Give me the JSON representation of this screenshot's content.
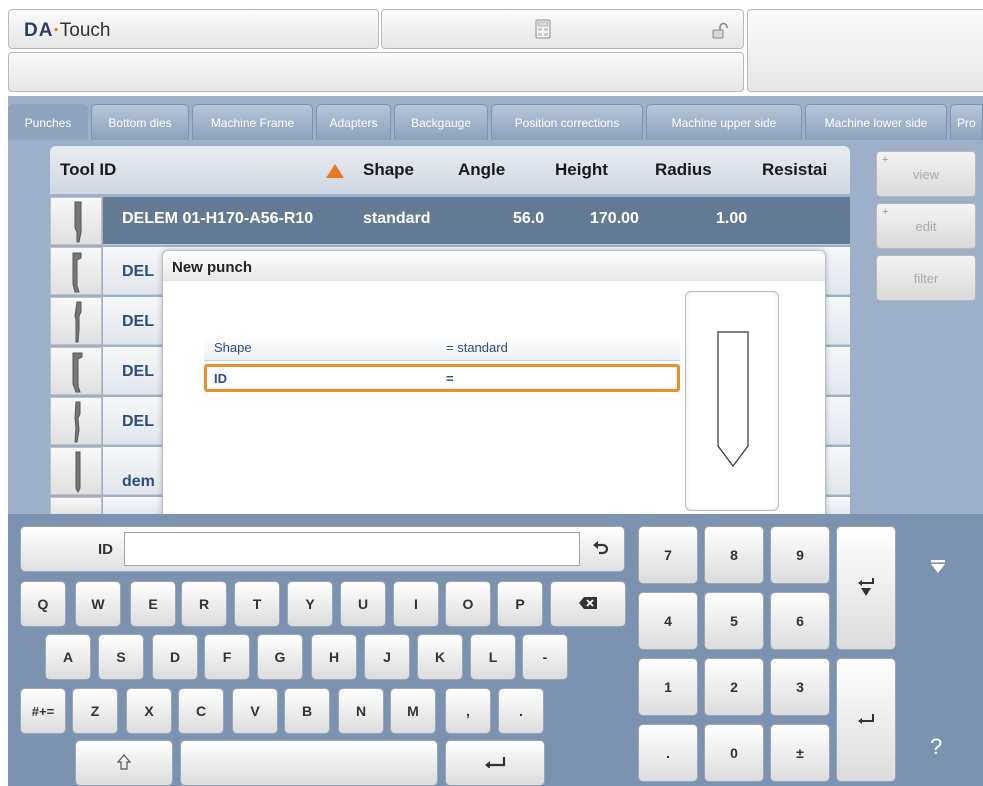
{
  "header": {
    "logo_brand": "DA",
    "logo_dot": "·",
    "logo_product": "Touch",
    "calculator_icon": "calculator-icon",
    "lock_icon": "unlocked-padlock-icon"
  },
  "tabs": [
    {
      "label": "Punches",
      "active": true
    },
    {
      "label": "Bottom dies"
    },
    {
      "label": "Machine Frame"
    },
    {
      "label": "Adapters"
    },
    {
      "label": "Backgauge"
    },
    {
      "label": "Position corrections"
    },
    {
      "label": "Machine upper side"
    },
    {
      "label": "Machine lower side"
    },
    {
      "label": "Pro"
    }
  ],
  "table": {
    "columns": [
      "Tool ID",
      "Shape",
      "Angle",
      "Height",
      "Radius",
      "Resistai"
    ],
    "sort_icon": "sort-ascending-triangle-icon",
    "rows": [
      {
        "id": "DELEM 01-H170-A56-R10",
        "shape": "standard",
        "angle": "56.0",
        "height": "170.00",
        "radius": "1.00",
        "selected": true
      },
      {
        "id": "DEL"
      },
      {
        "id": "DEL"
      },
      {
        "id": "DEL"
      },
      {
        "id": "DEL"
      },
      {
        "id": "dem"
      }
    ]
  },
  "side_buttons": {
    "view": "view",
    "edit": "edit",
    "filter": "filter",
    "plus": "+"
  },
  "dialog": {
    "title": "New punch",
    "fields": [
      {
        "label": "Shape",
        "value": "= standard"
      },
      {
        "label": "ID",
        "value": "="
      }
    ]
  },
  "keyboard": {
    "id_label": "ID",
    "id_value": "",
    "undo_icon": "undo-arrow-icon",
    "row1": [
      "Q",
      "W",
      "E",
      "R",
      "T",
      "Y",
      "U",
      "I",
      "O",
      "P"
    ],
    "row2": [
      "A",
      "S",
      "D",
      "F",
      "G",
      "H",
      "J",
      "K",
      "L",
      "-"
    ],
    "row3": [
      "Z",
      "X",
      "C",
      "V",
      "B",
      "N",
      "M",
      ",",
      "."
    ],
    "symbols_key": "#+=",
    "backspace_icon": "backspace-icon",
    "shift_icon": "shift-arrow-icon",
    "enter_icon": "enter-return-icon",
    "numpad": [
      "7",
      "8",
      "9",
      "4",
      "5",
      "6",
      "1",
      "2",
      "3",
      ".",
      "0",
      "±"
    ],
    "help": "?",
    "collapse_icon": "collapse-keyboard-icon"
  }
}
